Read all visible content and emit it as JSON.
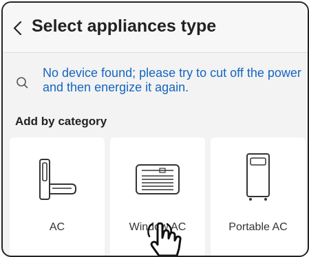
{
  "header": {
    "title": "Select appliances type",
    "back_icon": "chevron-left-icon"
  },
  "notice": {
    "icon": "search-icon",
    "text": "No device found; please try to cut off the power and then energize it again.",
    "color": "#1565c0"
  },
  "section": {
    "label": "Add by category"
  },
  "categories": [
    {
      "label": "AC",
      "icon": "split-ac-icon"
    },
    {
      "label": "Window AC",
      "icon": "window-ac-icon"
    },
    {
      "label": "Portable AC",
      "icon": "portable-ac-icon"
    }
  ],
  "pointer": {
    "icon": "tap-hand-icon"
  }
}
